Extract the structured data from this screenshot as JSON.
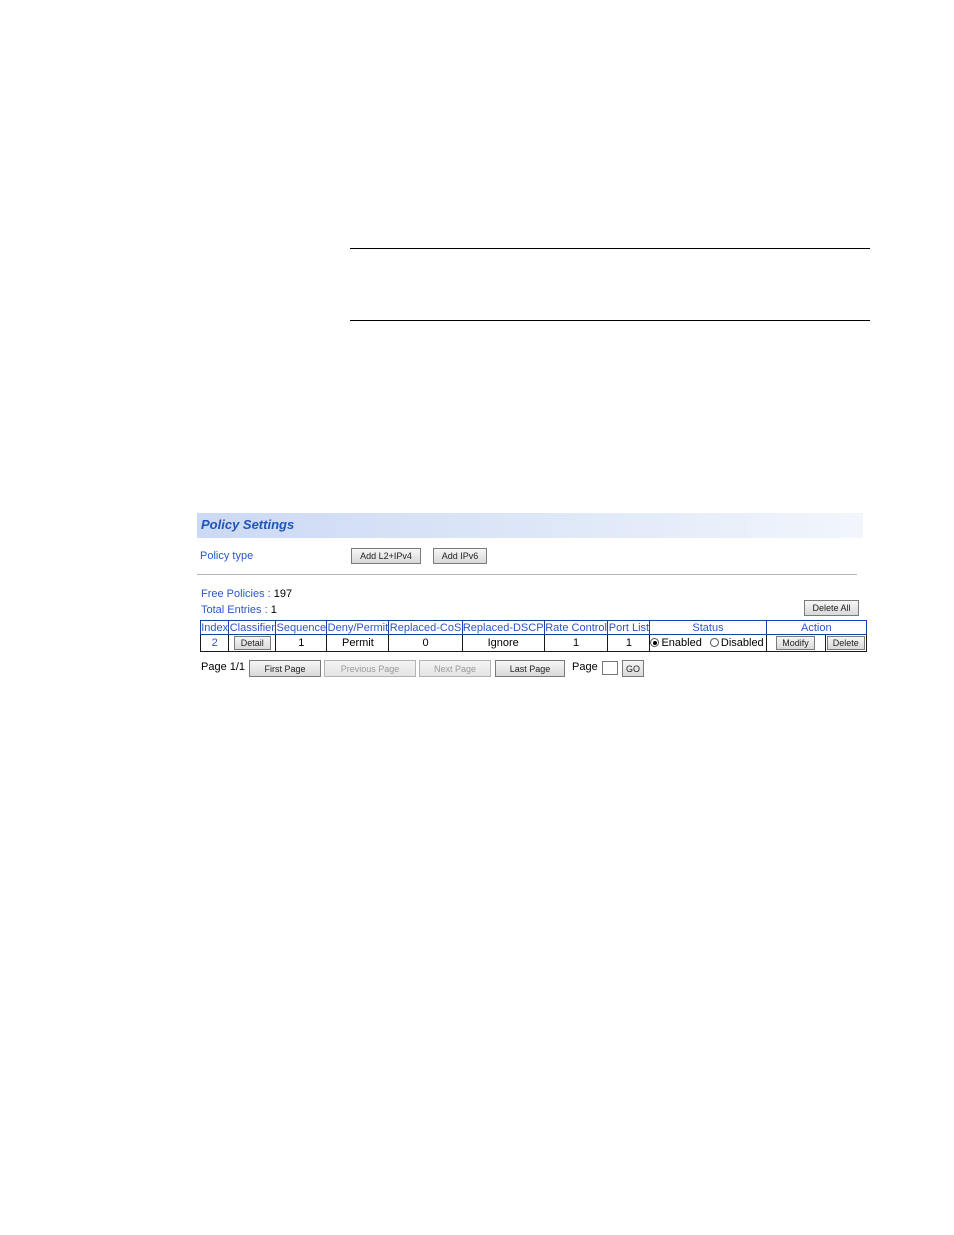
{
  "panel": {
    "title": "Policy Settings",
    "policy_type_label": "Policy type",
    "add_l2_ipv4_label": "Add L2+IPv4",
    "add_ipv6_label": "Add IPv6",
    "free_policies_label": "Free Policies :",
    "free_policies_value": "197",
    "total_entries_label": "Total Entries :",
    "total_entries_value": "1",
    "delete_all_label": "Delete All"
  },
  "table": {
    "headers": [
      "Index",
      "Classifier",
      "Sequence",
      "Deny/Permit",
      "Replaced-CoS",
      "Replaced-DSCP",
      "Rate Control",
      "Port List",
      "Status",
      "Action"
    ],
    "rows": [
      {
        "index": "2",
        "classifier_button": "Detail",
        "sequence": "1",
        "deny_permit": "Permit",
        "replaced_cos": "0",
        "replaced_dscp": "Ignore",
        "rate_control": "1",
        "port_list": "1",
        "status_enabled_label": "Enabled",
        "status_disabled_label": "Disabled",
        "status_selected": "Enabled",
        "modify_label": "Modify",
        "delete_label": "Delete"
      }
    ]
  },
  "pager": {
    "page_info": "Page 1/1",
    "first_label": "First Page",
    "previous_label": "Previous Page",
    "next_label": "Next Page",
    "last_label": "Last Page",
    "page_label": "Page",
    "go_label": "GO"
  }
}
